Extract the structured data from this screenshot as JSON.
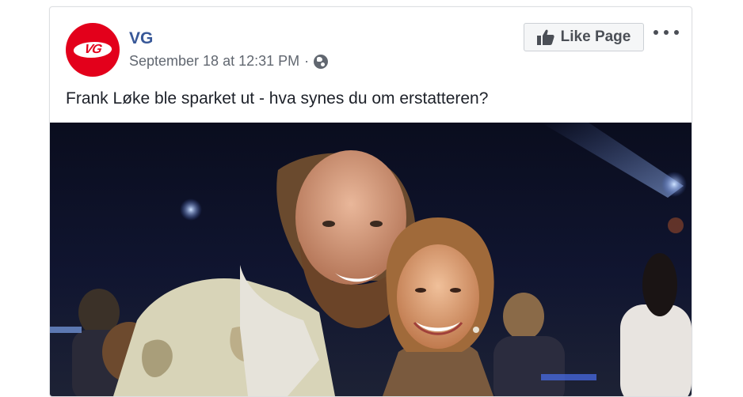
{
  "post": {
    "page_name": "VG",
    "avatar_text": "VG",
    "timestamp": "September 18 at 12:31 PM",
    "separator": "·",
    "privacy_icon": "globe-icon",
    "like_page_label": "Like Page",
    "more_icon": "more-options-icon",
    "text": "Frank Løke ble sparket ut - hva synes du om erstatteren?",
    "brand_color": "#e3001b",
    "link_color": "#385898"
  },
  "photo": {
    "description_icon": "post-photo",
    "subjects": [
      "man-with-beard",
      "smiling-woman"
    ]
  }
}
